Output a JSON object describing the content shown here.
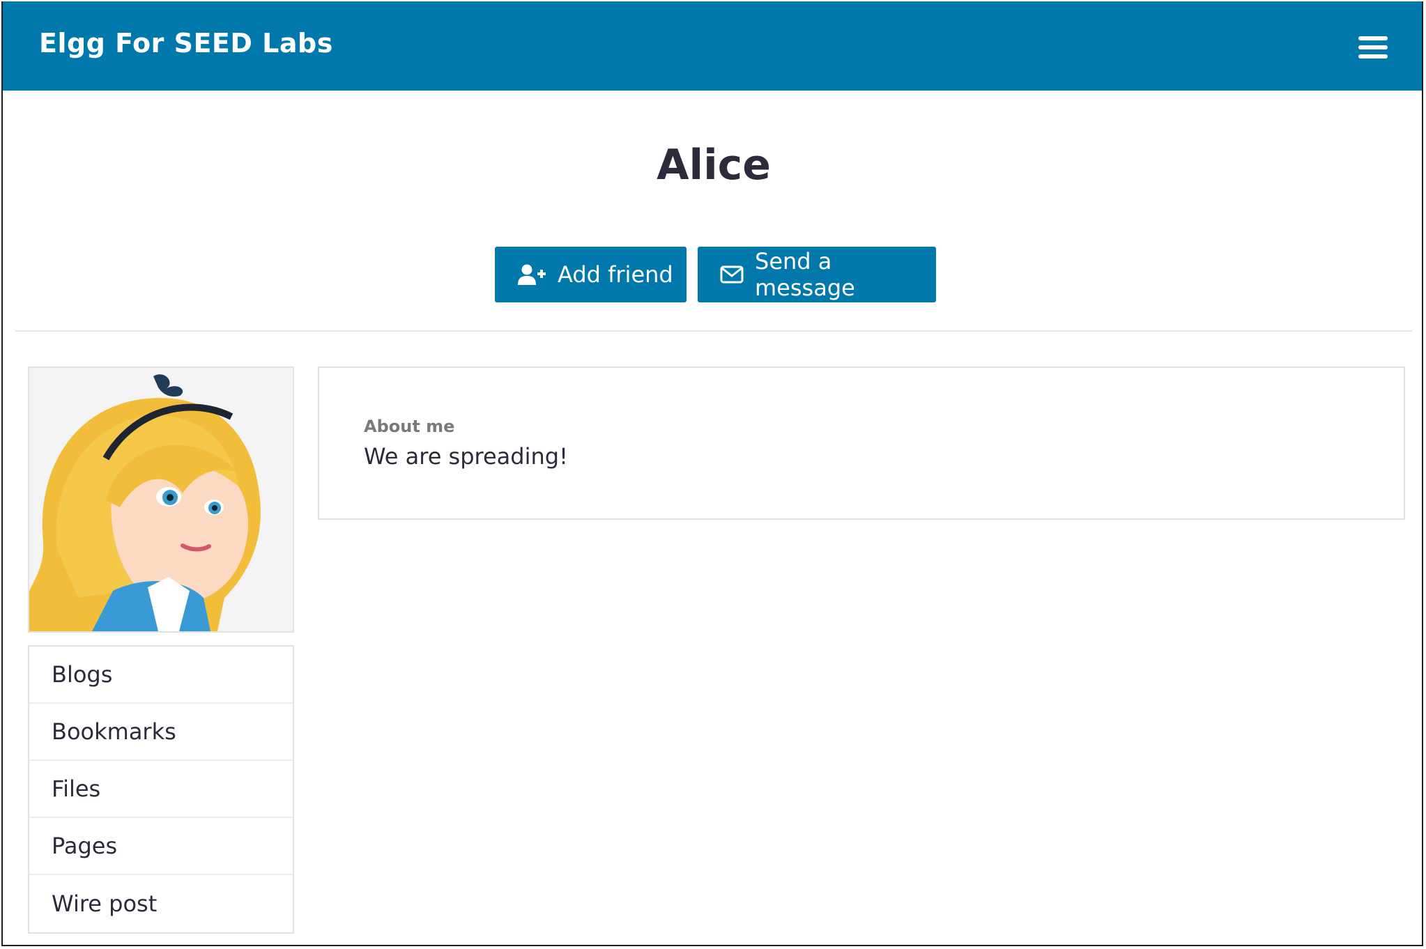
{
  "header": {
    "site_title": "Elgg For SEED Labs",
    "menu_icon": "hamburger-icon",
    "bg_color": "#0078ac"
  },
  "profile": {
    "name": "Alice",
    "avatar_alt": "Alice"
  },
  "actions": {
    "add_friend_label": "Add friend",
    "add_friend_icon": "user-plus-icon",
    "send_message_label": "Send a message",
    "send_message_icon": "envelope-icon"
  },
  "about": {
    "label": "About me",
    "text": "We are spreading!"
  },
  "sidebar": {
    "items": [
      {
        "label": "Blogs"
      },
      {
        "label": "Bookmarks"
      },
      {
        "label": "Files"
      },
      {
        "label": "Pages"
      },
      {
        "label": "Wire post"
      }
    ]
  }
}
